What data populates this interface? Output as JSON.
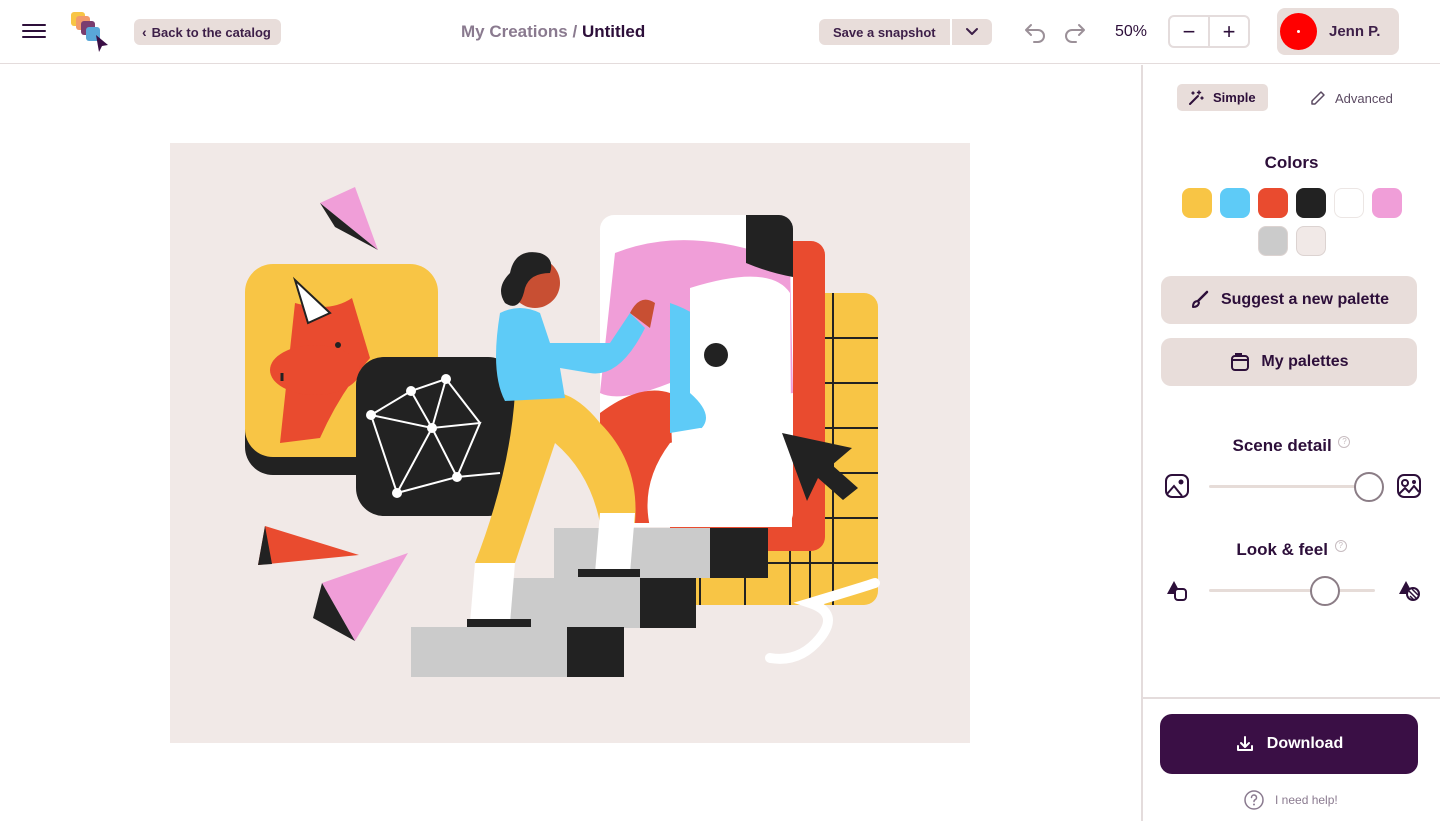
{
  "header": {
    "back_label": "Back to the catalog",
    "breadcrumb_parent": "My Creations /",
    "breadcrumb_current": "Untitled",
    "snapshot_label": "Save a snapshot",
    "zoom": "50%",
    "zoom_out": "−",
    "zoom_in": "+",
    "user_name": "Jenn P."
  },
  "panel": {
    "mode_simple": "Simple",
    "mode_advanced": "Advanced",
    "colors_title": "Colors",
    "colors": [
      "#f8c545",
      "#5ecbf7",
      "#e94b2f",
      "#222222",
      "#ffffff",
      "#f09ed8",
      "#cbcbcb",
      "#f1e9e7"
    ],
    "suggest_label": "Suggest a new palette",
    "palettes_label": "My palettes",
    "scene_detail_title": "Scene detail",
    "scene_detail_value": 0.95,
    "look_feel_title": "Look & feel",
    "look_feel_value": 0.7,
    "help_marker": "?",
    "download_label": "Download",
    "help_label": "I need help!"
  }
}
